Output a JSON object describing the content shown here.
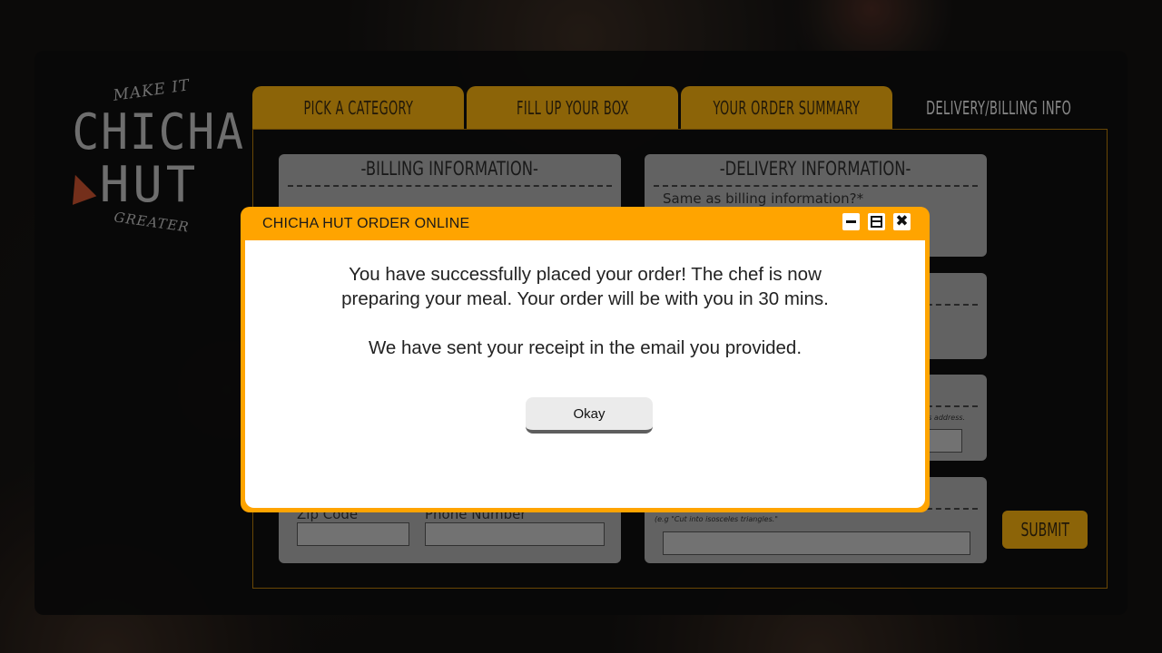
{
  "logo": {
    "top_text": "MAKE IT",
    "name_line1": "CHICHA",
    "name_line2": "HUT",
    "bottom_text": "GREATER"
  },
  "tabs": [
    {
      "label": "PICK A CATEGORY",
      "active": false
    },
    {
      "label": "FILL UP YOUR BOX",
      "active": false
    },
    {
      "label": "YOUR ORDER SUMMARY",
      "active": false
    },
    {
      "label": "DELIVERY/BILLING INFO",
      "active": true
    }
  ],
  "billing": {
    "title": "-BILLING INFORMATION-",
    "zip_label": "Zip Code",
    "phone_label": "Phone Number"
  },
  "delivery": {
    "title": "-DELIVERY INFORMATION-",
    "same_as_billing": "Same as billing information?*",
    "address_hint": "is address.",
    "instructions_hint": "(e.g \"Cut into isosceles triangles.\""
  },
  "submit_label": "SUBMIT",
  "dialog": {
    "title": "CHICHA HUT ORDER ONLINE",
    "message_line1": "You have successfully placed your order! The chef is now",
    "message_line2": "preparing your meal. Your order will be with you in 30 mins.",
    "message_line3": "We have sent your receipt in the email you provided.",
    "button_label": "Okay"
  },
  "colors": {
    "accent": "#ffa400",
    "tab": "#f2ad0e",
    "panel": "#0e0e0e"
  }
}
